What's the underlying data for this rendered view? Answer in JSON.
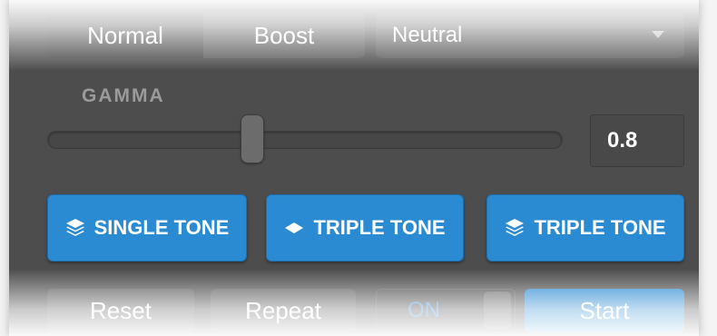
{
  "mode_toggle": {
    "options": [
      "Normal",
      "Boost"
    ]
  },
  "select": {
    "value": "Neutral"
  },
  "gamma": {
    "label": "GAMMA",
    "value": "0.8",
    "slider_fraction": 0.4
  },
  "tone_buttons": [
    {
      "label": "SINGLE TONE",
      "icon": "layers-icon"
    },
    {
      "label": "TRIPLE TONE",
      "icon": "diamond-icon"
    },
    {
      "label": "TRIPLE TONE",
      "icon": "layers-icon"
    }
  ],
  "bottom": {
    "reset_label": "Reset",
    "repeat_label": "Repeat",
    "switch_label": "ON",
    "start_label": "Start"
  },
  "colors": {
    "accent": "#2a8ad2",
    "panel": "#4d4d4d",
    "switch_text": "#3b8fd6"
  }
}
